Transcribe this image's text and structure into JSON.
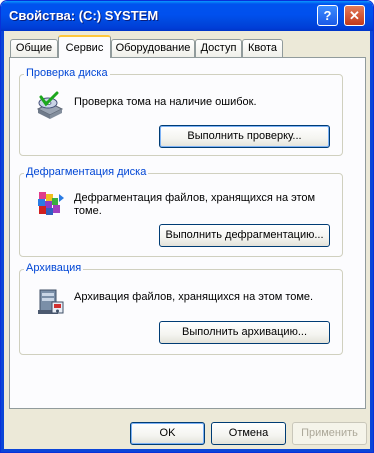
{
  "window": {
    "title": "Свойства: (C:) SYSTEM"
  },
  "titlebar_buttons": {
    "help": "?",
    "close": "✕"
  },
  "tabs": [
    {
      "label": "Общие",
      "active": false
    },
    {
      "label": "Сервис",
      "active": true
    },
    {
      "label": "Оборудование",
      "active": false
    },
    {
      "label": "Доступ",
      "active": false
    },
    {
      "label": "Квота",
      "active": false
    }
  ],
  "groups": {
    "check": {
      "title": "Проверка диска",
      "description": "Проверка тома на наличие ошибок.",
      "button": "Выполнить проверку...",
      "icon": "disk-check-icon"
    },
    "defrag": {
      "title": "Дефрагментация диска",
      "description": "Дефрагментация файлов, хранящихся на этом томе.",
      "button": "Выполнить дефрагментацию...",
      "icon": "defrag-icon"
    },
    "backup": {
      "title": "Архивация",
      "description": "Архивация файлов, хранящихся на этом томе.",
      "button": "Выполнить архивацию...",
      "icon": "backup-icon"
    }
  },
  "footer": {
    "ok": "OK",
    "cancel": "Отмена",
    "apply": "Применить"
  },
  "colors": {
    "titlebar": "#0053ee",
    "group_title": "#0046d5",
    "dialog_bg": "#ece9d8"
  }
}
